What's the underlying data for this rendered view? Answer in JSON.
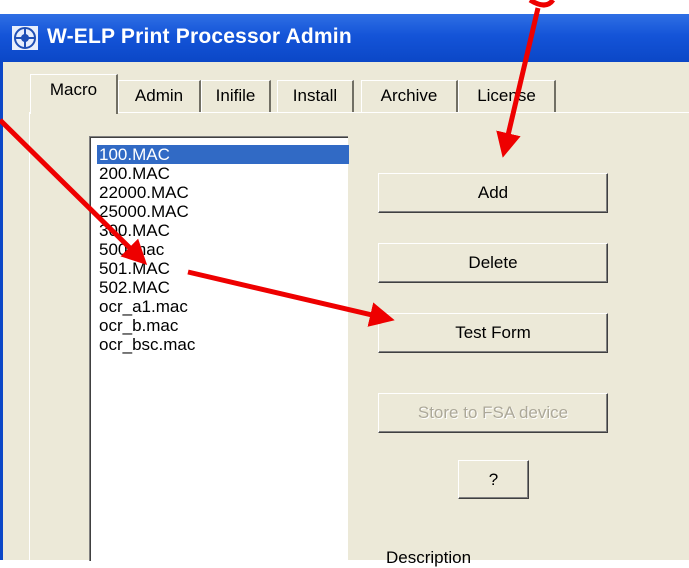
{
  "window": {
    "title": "W-ELP Print Processor Admin"
  },
  "tabs": [
    "Macro",
    "Admin",
    "Inifile",
    "Install",
    "Archive",
    "License"
  ],
  "macro_list": [
    "100.MAC",
    "200.MAC",
    "22000.MAC",
    "25000.MAC",
    "300.MAC",
    "500.mac",
    "501.MAC",
    "502.MAC",
    "ocr_a1.mac",
    "ocr_b.mac",
    "ocr_bsc.mac"
  ],
  "selected_item": "100.MAC",
  "buttons": {
    "add": "Add",
    "delete": "Delete",
    "test_form": "Test Form",
    "store_fsa": "Store to FSA device",
    "help": "?"
  },
  "description_label": "Description",
  "colors": {
    "titlebar": "#0b47c7",
    "selection": "#316ac5",
    "annotation_arrows": "#ee0000"
  },
  "icons": [
    "app-icon"
  ]
}
